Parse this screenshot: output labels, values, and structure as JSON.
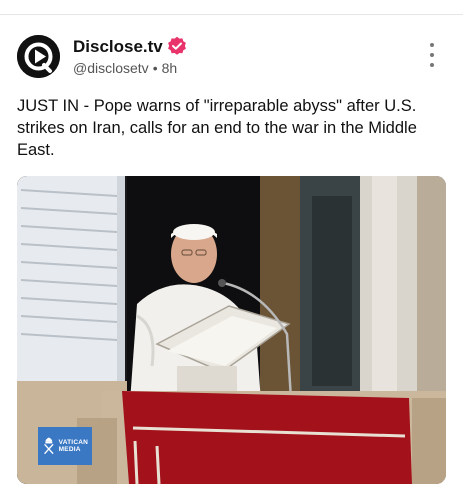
{
  "author": {
    "name": "Disclose.tv",
    "handle": "@disclosetv",
    "time": "8h",
    "verified_color": "#e8336b"
  },
  "post": {
    "text": "JUST IN - Pope warns of \"irreparable abyss\" after U.S. strikes on Iran, calls for an end to the war in the Middle East."
  },
  "media": {
    "watermark_lines": [
      "VATICAN",
      "MEDIA"
    ],
    "watermark_color": "#3b78c4"
  },
  "icons": {
    "avatar": "play-logo-icon",
    "verified": "verified-badge-icon",
    "more": "more-options-icon"
  }
}
